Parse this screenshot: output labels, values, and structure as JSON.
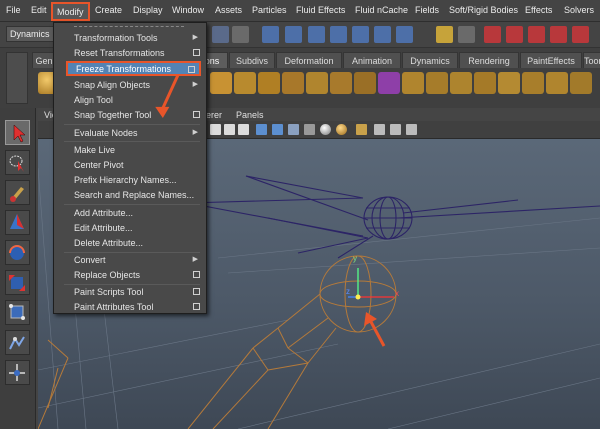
{
  "menubar": {
    "items": [
      "File",
      "Edit",
      "Modify",
      "Create",
      "Display",
      "Window",
      "Assets",
      "Particles",
      "Fluid Effects",
      "Fluid nCache",
      "Fields",
      "Soft/Rigid Bodies",
      "Effects",
      "Solvers"
    ],
    "active_item": "Modify",
    "highlight_color": "#e8552a"
  },
  "statusline": {
    "mode": "Dynamics"
  },
  "shelf": {
    "tabs": [
      "Gen",
      "ons",
      "Subdivs",
      "Deformation",
      "Animation",
      "Dynamics",
      "Rendering",
      "PaintEffects",
      "Toon"
    ]
  },
  "panel": {
    "menu_items": [
      "Vie",
      "derer",
      "Panels"
    ]
  },
  "modify_menu": {
    "items": [
      {
        "label": "Transformation Tools",
        "suffix": "arrow"
      },
      {
        "label": "Reset Transformations",
        "suffix": "box"
      },
      {
        "label": "Freeze Transformations",
        "suffix": "box",
        "highlighted": true
      },
      {
        "label": "Snap Align Objects",
        "suffix": "arrow"
      },
      {
        "label": "Align Tool",
        "suffix": ""
      },
      {
        "label": "Snap Together Tool",
        "suffix": "box"
      },
      {
        "label": "Evaluate Nodes",
        "suffix": "arrow"
      },
      {
        "label": "Make Live",
        "suffix": ""
      },
      {
        "label": "Center Pivot",
        "suffix": ""
      },
      {
        "label": "Prefix Hierarchy Names...",
        "suffix": ""
      },
      {
        "label": "Search and Replace Names...",
        "suffix": ""
      },
      {
        "label": "Add Attribute...",
        "suffix": ""
      },
      {
        "label": "Edit Attribute...",
        "suffix": ""
      },
      {
        "label": "Delete Attribute...",
        "suffix": ""
      },
      {
        "label": "Convert",
        "suffix": "arrow"
      },
      {
        "label": "Replace Objects",
        "suffix": "box"
      },
      {
        "label": "Paint Scripts Tool",
        "suffix": "box"
      },
      {
        "label": "Paint Attributes Tool",
        "suffix": "box"
      }
    ]
  },
  "colors": {
    "menu_bg": "#494949",
    "highlight_bg": "#5383b4",
    "annotation": "#e8552a",
    "viewport_bg": "#55616f"
  }
}
